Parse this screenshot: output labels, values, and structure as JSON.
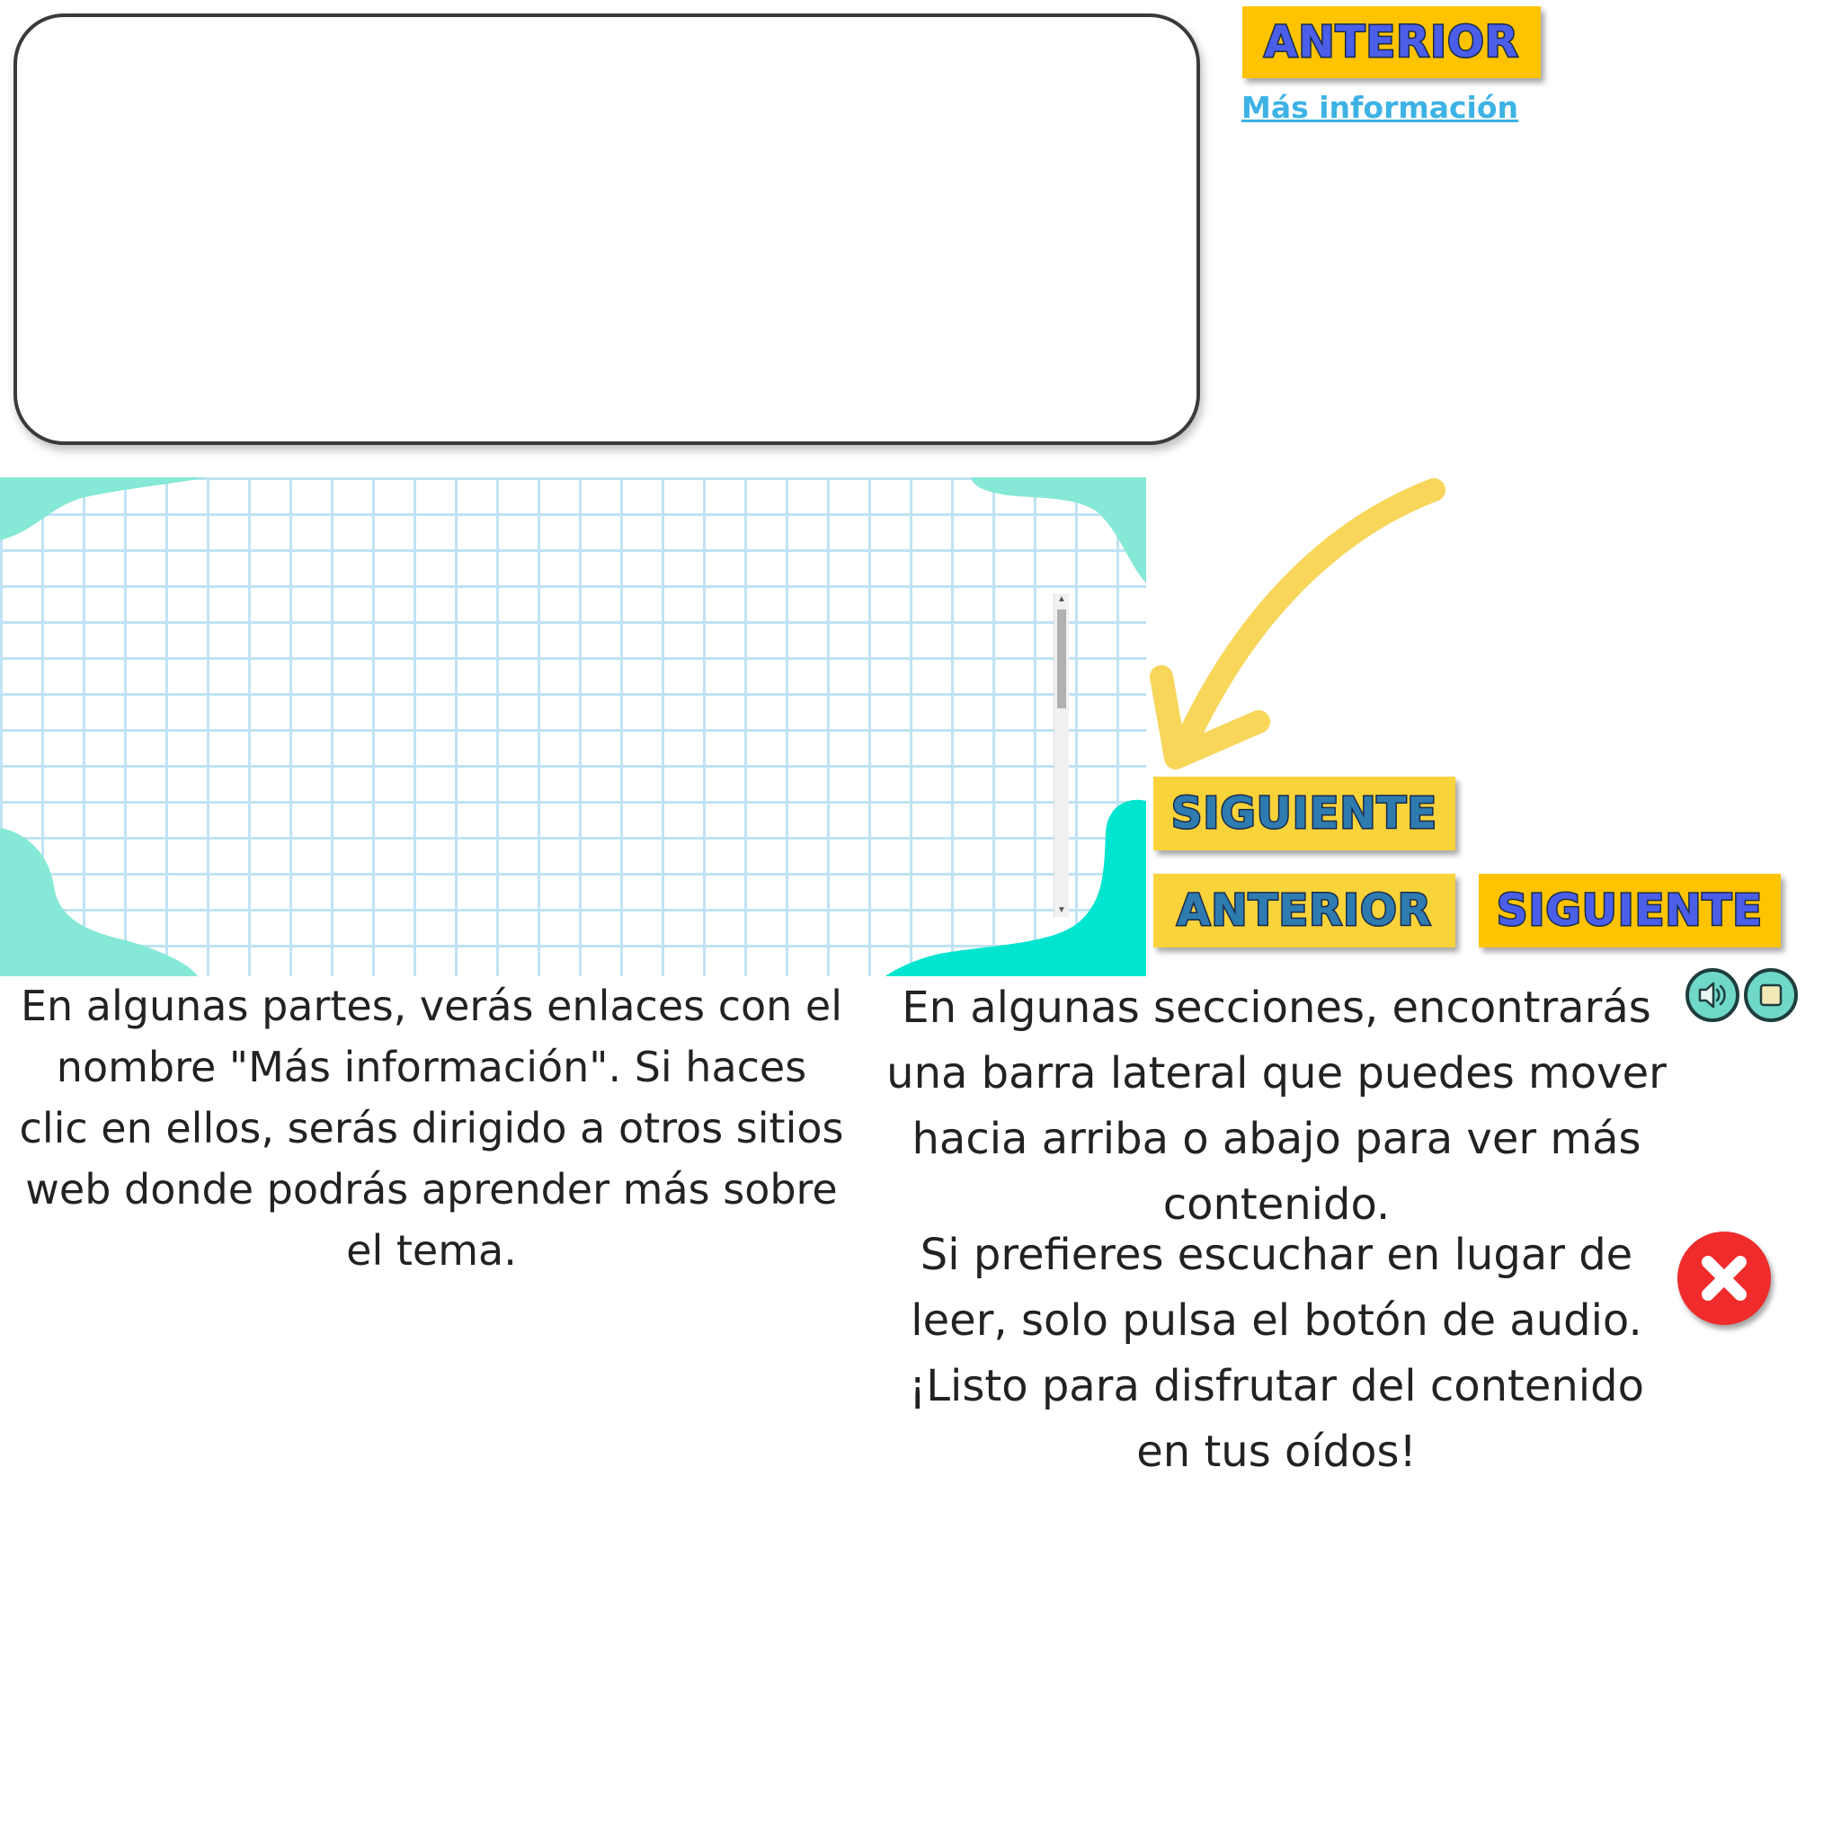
{
  "navigation": {
    "anterior_top_label": "ANTERIOR",
    "siguiente_label": "SIGUIENTE",
    "anterior_label": "ANTERIOR",
    "siguiente_2_label": "SIGUIENTE"
  },
  "links": {
    "more_info": "Más información"
  },
  "texts": {
    "links_explanation": "En algunas partes, verás enlaces con el nombre \"Más información\". Si haces clic en ellos, serás dirigido a otros sitios web donde podrás aprender más sobre el tema.",
    "sidebar_explanation": "En algunas secciones, encontrarás una barra lateral que puedes mover hacia arriba o abajo para ver más contenido.",
    "audio_explanation": "Si prefieres escuchar en lugar de leer, solo pulsa el botón de audio. ¡Listo para disfrutar del contenido en tus oídos!"
  },
  "icons": {
    "audio_play": "speaker-icon",
    "audio_stop": "stop-icon",
    "close": "close-icon",
    "arrow": "curved-arrow-icon"
  },
  "colors": {
    "button_yellow": "#ffc300",
    "button_yellow_soft": "#f9d33a",
    "button_text_blue": "#4a5ee8",
    "button_text_teal": "#2e7bb0",
    "link_blue": "#3db2e5",
    "grid_line": "#bfe3f4",
    "blob_mint": "#86e8d6",
    "blob_teal": "#00e5cf",
    "arrow_yellow": "#f7d65a",
    "close_red": "#ef2b2b",
    "audio_teal": "#6fd8c8"
  }
}
